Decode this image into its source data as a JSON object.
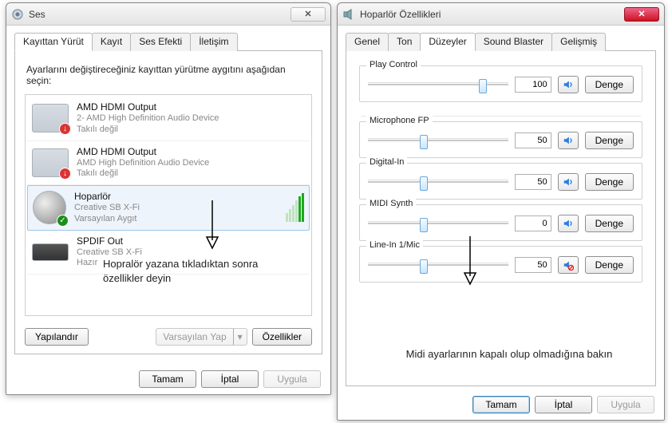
{
  "left": {
    "title": "Ses",
    "tabs": [
      "Kayıttan Yürüt",
      "Kayıt",
      "Ses Efekti",
      "İletişim"
    ],
    "active_tab": 0,
    "description": "Ayarlarını değiştireceğiniz kayıttan yürütme aygıtını aşağıdan seçin:",
    "devices": [
      {
        "name": "AMD HDMI Output",
        "sub1": "2- AMD High Definition Audio Device",
        "sub2": "Takılı değil",
        "badge": "down"
      },
      {
        "name": "AMD HDMI Output",
        "sub1": "AMD High Definition Audio Device",
        "sub2": "Takılı değil",
        "badge": "down"
      },
      {
        "name": "Hoparlör",
        "sub1": "Creative SB X-Fi",
        "sub2": "Varsayılan Aygıt",
        "badge": "ok",
        "selected": true,
        "level": true
      },
      {
        "name": "SPDIF Out",
        "sub1": "Creative SB X-Fi",
        "sub2": "Hazır",
        "badge": null
      }
    ],
    "buttons": {
      "configure": "Yapılandır",
      "set_default": "Varsayılan Yap",
      "properties": "Özellikler",
      "ok": "Tamam",
      "cancel": "İptal",
      "apply": "Uygula"
    },
    "annotation": "Hopralör yazana tıkladıktan sonra özellikler deyin"
  },
  "right": {
    "title": "Hoparlör Özellikleri",
    "tabs": [
      "Genel",
      "Ton",
      "Düzeyler",
      "Sound Blaster",
      "Gelişmiş"
    ],
    "active_tab": 2,
    "controls": [
      {
        "label": "Play Control",
        "value": 100,
        "pos": 82,
        "muted": false
      },
      {
        "label": "Microphone FP",
        "value": 50,
        "pos": 40,
        "muted": false
      },
      {
        "label": "Digital-In",
        "value": 50,
        "pos": 40,
        "muted": false
      },
      {
        "label": "MIDI Synth",
        "value": 0,
        "pos": 40,
        "muted": false
      },
      {
        "label": "Line-In 1/Mic",
        "value": 50,
        "pos": 40,
        "muted": true
      }
    ],
    "balance_label": "Denge",
    "buttons": {
      "ok": "Tamam",
      "cancel": "İptal",
      "apply": "Uygula"
    },
    "annotation": "Midi ayarlarının kapalı olup olmadığına bakın"
  }
}
